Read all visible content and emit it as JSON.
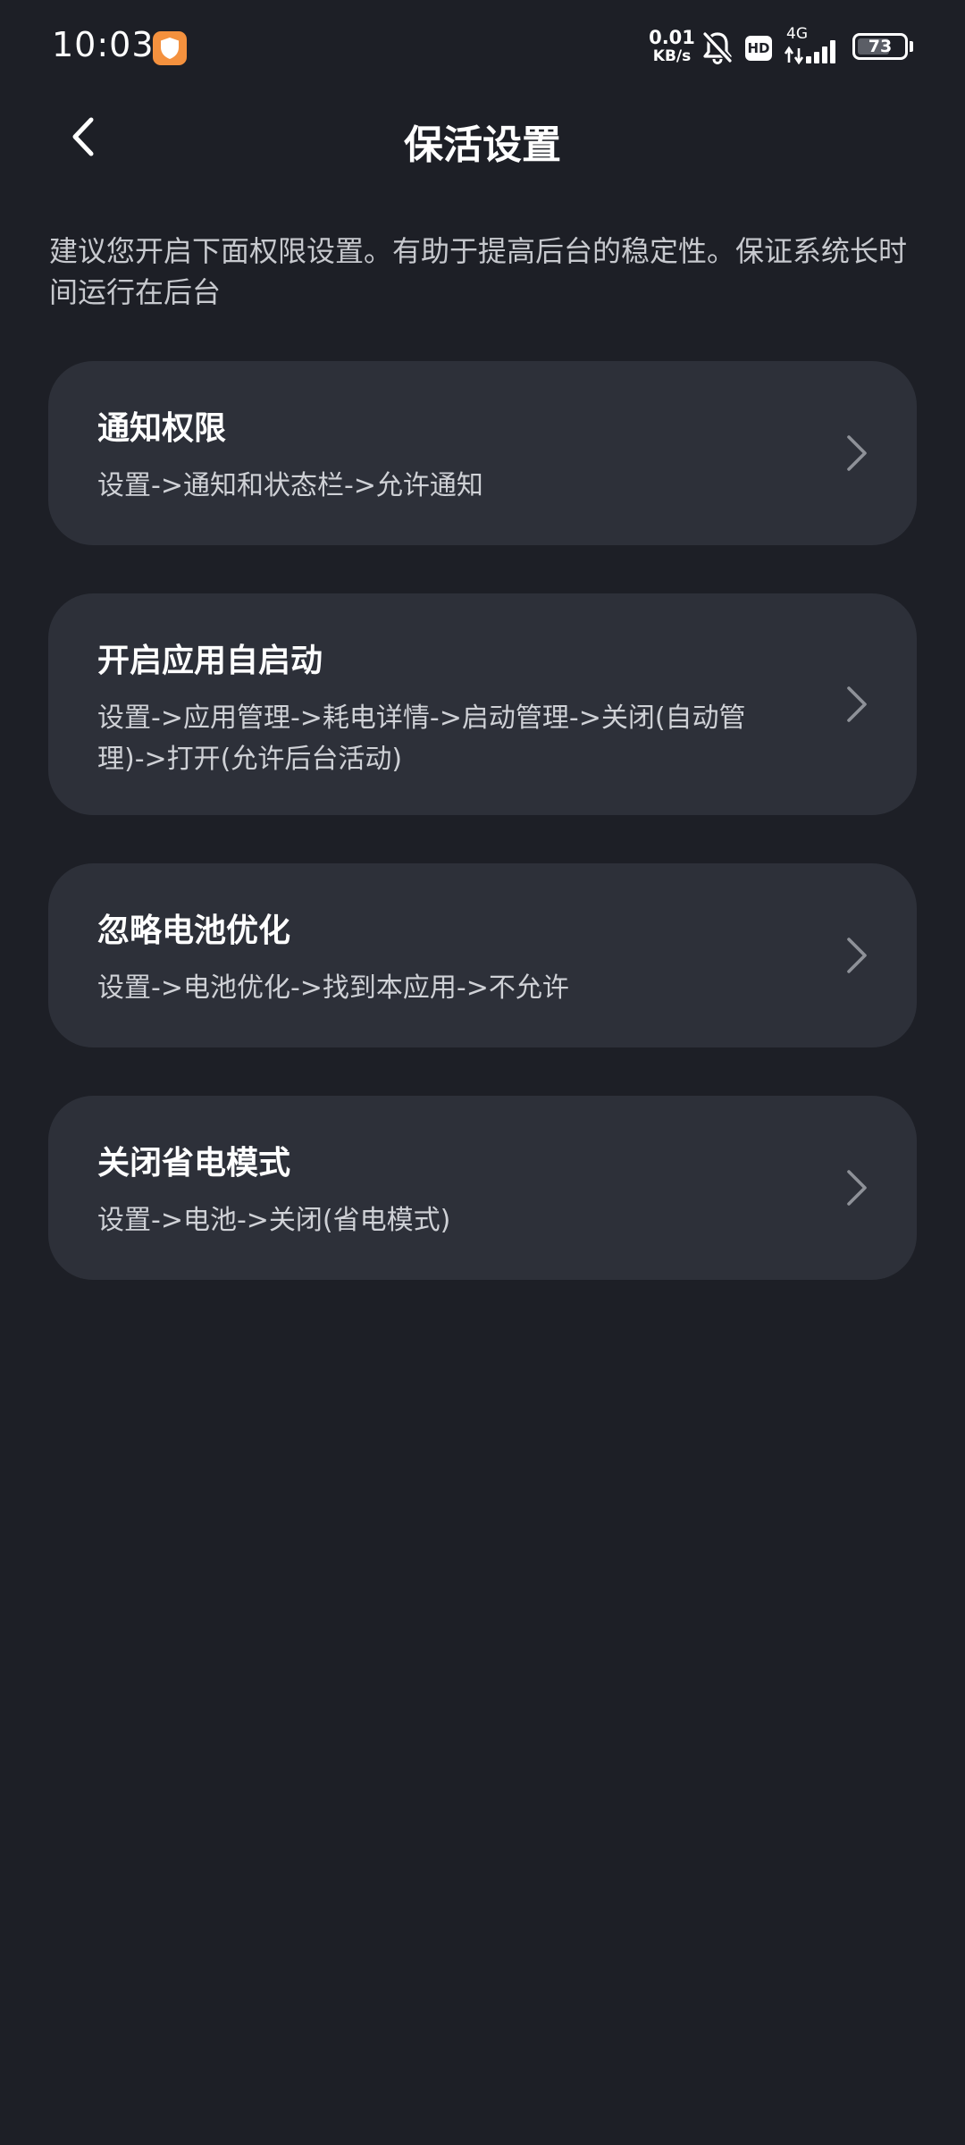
{
  "status_bar": {
    "time": "10:03",
    "net_speed_value": "0.01",
    "net_speed_unit": "KB/s",
    "hd_label": "HD",
    "network_type": "4G",
    "battery_level": "73",
    "battery_fraction": 0.73,
    "icons": [
      "shield-app-icon",
      "bell-off-icon",
      "hd-icon",
      "signal-icon",
      "battery-icon"
    ]
  },
  "header": {
    "title": "保活设置",
    "back_icon": "chevron-left-icon"
  },
  "description": "建议您开启下面权限设置。有助于提高后台的稳定性。保证系统长时间运行在后台",
  "cards": [
    {
      "title": "通知权限",
      "desc": "设置->通知和状态栏->允许通知"
    },
    {
      "title": "开启应用自启动",
      "desc": "设置->应用管理->耗电详情->启动管理->关闭(自动管理)->打开(允许后台活动)"
    },
    {
      "title": "忽略电池优化",
      "desc": "设置->电池优化->找到本应用->不允许"
    },
    {
      "title": "关闭省电模式",
      "desc": "设置->电池->关闭(省电模式)"
    }
  ],
  "colors": {
    "background": "#1d1f26",
    "card": "#2d3039",
    "app_badge": "#f4913e"
  }
}
